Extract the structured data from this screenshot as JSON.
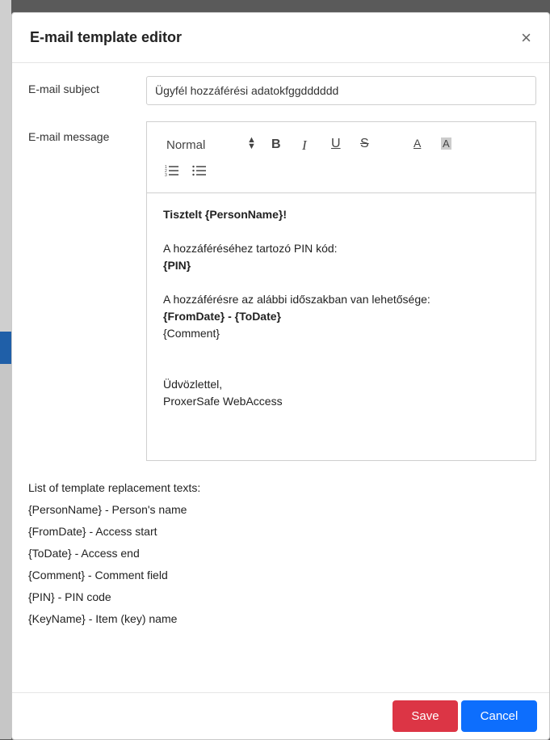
{
  "dialog": {
    "title": "E-mail template editor",
    "close_glyph": "×"
  },
  "subject": {
    "label": "E-mail subject",
    "value": "Ügyfél hozzáférési adatokfggdddddd"
  },
  "message": {
    "label": "E-mail message",
    "toolbar": {
      "font_size": "Normal",
      "bold": "B",
      "italic": "I",
      "underline": "U",
      "strike": "S",
      "text_color": "A",
      "background": "A"
    },
    "body": {
      "greeting": "Tisztelt {PersonName}!",
      "pin_label": "A hozzáféréséhez tartozó PIN kód:",
      "pin_value": "{PIN}",
      "period_label": "A hozzáférésre az alábbi időszakban van lehetősége:",
      "period_value": "{FromDate} - {ToDate}",
      "comment": "{Comment}",
      "closing": "Üdvözlettel,",
      "signature": "ProxerSafe WebAccess"
    }
  },
  "replacements": {
    "heading": "List of template replacement texts:",
    "items": [
      "{PersonName} - Person's name",
      "{FromDate} - Access start",
      "{ToDate} - Access end",
      "{Comment} - Comment field",
      "{PIN} - PIN code",
      "{KeyName} - Item (key) name"
    ]
  },
  "footer": {
    "save_label": "Save",
    "cancel_label": "Cancel"
  },
  "colors": {
    "save": "#dc3545",
    "cancel": "#0d6efd"
  }
}
